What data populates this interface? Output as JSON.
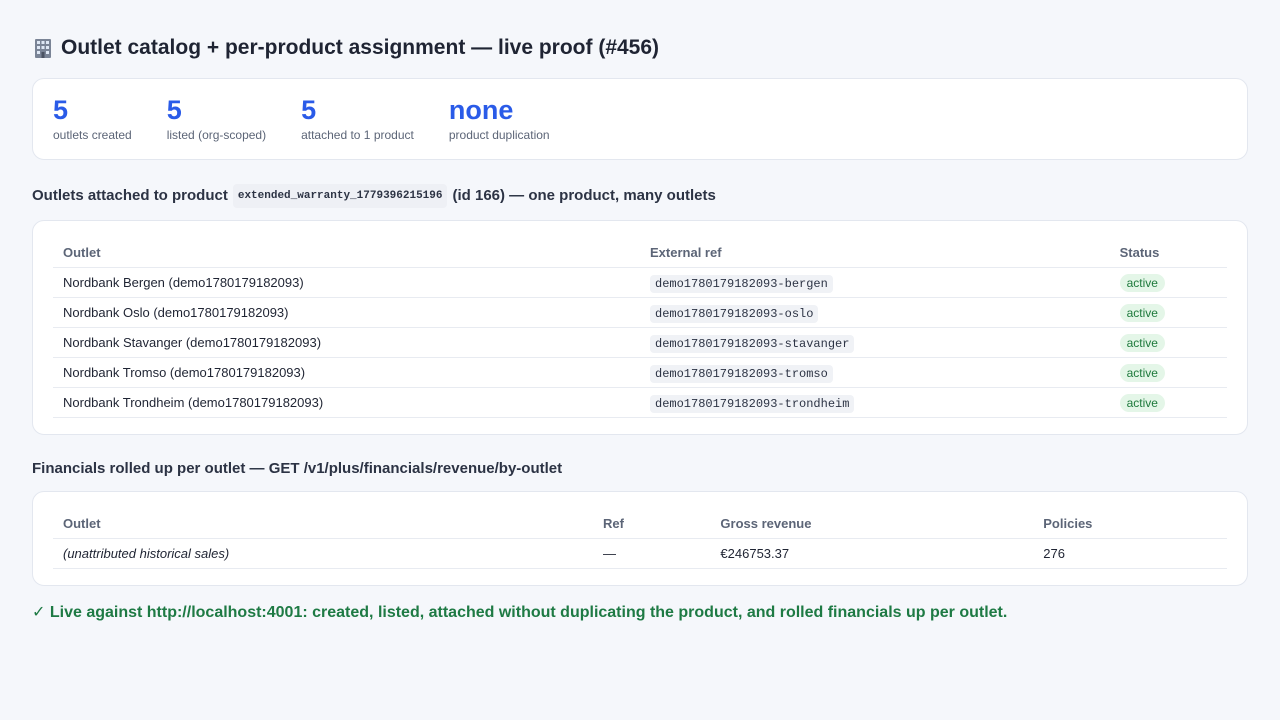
{
  "header": {
    "icon": "office-building-icon",
    "title": "Outlet catalog + per-product assignment — live proof (#456)"
  },
  "stats": [
    {
      "value": "5",
      "label": "outlets created"
    },
    {
      "value": "5",
      "label": "listed (org-scoped)"
    },
    {
      "value": "5",
      "label": "attached to 1 product"
    },
    {
      "value": "none",
      "label": "product duplication"
    }
  ],
  "outlets_section": {
    "title_prefix": "Outlets attached to product",
    "product_code": "extended_warranty_1779396215196",
    "title_suffix": "(id 166) — one product, many outlets",
    "columns": [
      "Outlet",
      "External ref",
      "Status"
    ],
    "rows": [
      {
        "outlet": "Nordbank Bergen (demo1780179182093)",
        "ref": "demo1780179182093-bergen",
        "status": "active"
      },
      {
        "outlet": "Nordbank Oslo (demo1780179182093)",
        "ref": "demo1780179182093-oslo",
        "status": "active"
      },
      {
        "outlet": "Nordbank Stavanger (demo1780179182093)",
        "ref": "demo1780179182093-stavanger",
        "status": "active"
      },
      {
        "outlet": "Nordbank Tromso (demo1780179182093)",
        "ref": "demo1780179182093-tromso",
        "status": "active"
      },
      {
        "outlet": "Nordbank Trondheim (demo1780179182093)",
        "ref": "demo1780179182093-trondheim",
        "status": "active"
      }
    ]
  },
  "financials_section": {
    "title": "Financials rolled up per outlet — GET /v1/plus/financials/revenue/by-outlet",
    "columns": [
      "Outlet",
      "Ref",
      "Gross revenue",
      "Policies"
    ],
    "rows": [
      {
        "outlet": "(unattributed historical sales)",
        "ref": "—",
        "gross_revenue": "€246753.37",
        "policies": "276"
      }
    ]
  },
  "footer": {
    "text": "✓ Live against http://localhost:4001: created, listed, attached without duplicating the product, and rolled financials up per outlet."
  },
  "colors": {
    "accent": "#2a5be8",
    "success": "#1e7a44",
    "badge_bg": "#e4f6e8"
  }
}
